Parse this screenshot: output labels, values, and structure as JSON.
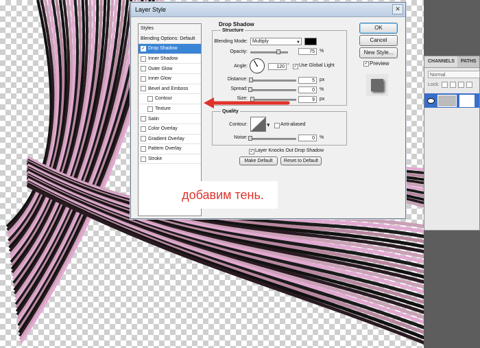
{
  "dialog": {
    "title": "Layer Style",
    "close_glyph": "✕",
    "styles_list": [
      {
        "label": "Styles",
        "type": "header",
        "checked": false
      },
      {
        "label": "Blending Options: Default",
        "type": "header",
        "checked": false
      },
      {
        "label": "Drop Shadow",
        "type": "item",
        "checked": true,
        "selected": true
      },
      {
        "label": "Inner Shadow",
        "type": "item",
        "checked": false
      },
      {
        "label": "Outer Glow",
        "type": "item",
        "checked": false
      },
      {
        "label": "Inner Glow",
        "type": "item",
        "checked": false
      },
      {
        "label": "Bevel and Emboss",
        "type": "item",
        "checked": false
      },
      {
        "label": "Contour",
        "type": "subitem",
        "checked": false
      },
      {
        "label": "Texture",
        "type": "subitem",
        "checked": false
      },
      {
        "label": "Satin",
        "type": "item",
        "checked": false
      },
      {
        "label": "Color Overlay",
        "type": "item",
        "checked": false
      },
      {
        "label": "Gradient Overlay",
        "type": "item",
        "checked": false
      },
      {
        "label": "Pattern Overlay",
        "type": "item",
        "checked": false
      },
      {
        "label": "Stroke",
        "type": "item",
        "checked": false
      }
    ],
    "drop_shadow": {
      "section_title": "Drop Shadow",
      "structure_title": "Structure",
      "blend_mode_label": "Blending Mode:",
      "blend_mode_value": "Multiply",
      "shadow_color": "#000000",
      "opacity_label": "Opacity:",
      "opacity_value": "75",
      "opacity_fraction": 0.75,
      "angle_label": "Angle:",
      "angle_value": "120",
      "angle_degrees": 120,
      "use_global_light_label": "Use Global Light",
      "use_global_light_checked": true,
      "distance_label": "Distance:",
      "distance_value": "5",
      "distance_fraction": 0.02,
      "spread_label": "Spread:",
      "spread_value": "0",
      "spread_fraction": 0.0,
      "size_label": "Size:",
      "size_value": "9",
      "size_fraction": 0.05,
      "unit_px": "px",
      "unit_percent": "%",
      "degree_glyph": "°",
      "quality_title": "Quality",
      "contour_label": "Contour:",
      "anti_aliased_label": "Anti-aliased",
      "anti_aliased_checked": false,
      "noise_label": "Noise:",
      "noise_value": "0",
      "noise_fraction": 0.0,
      "layer_knocks_label": "Layer Knocks Out Drop Shadow",
      "layer_knocks_checked": true,
      "make_default_label": "Make Default",
      "reset_default_label": "Reset to Default"
    },
    "buttons": {
      "ok_label": "OK",
      "cancel_label": "Cancel",
      "new_style_label": "New Style...",
      "preview_label": "Preview",
      "preview_checked": true
    }
  },
  "layers_panel": {
    "tabs": [
      "CHANNELS",
      "PATHS"
    ],
    "blend_mode": "Normal",
    "lock_label": "Lock:"
  },
  "annotation": {
    "text": "добавим тень.",
    "color": "#e0332a"
  },
  "arrow_color": "#e0332a"
}
